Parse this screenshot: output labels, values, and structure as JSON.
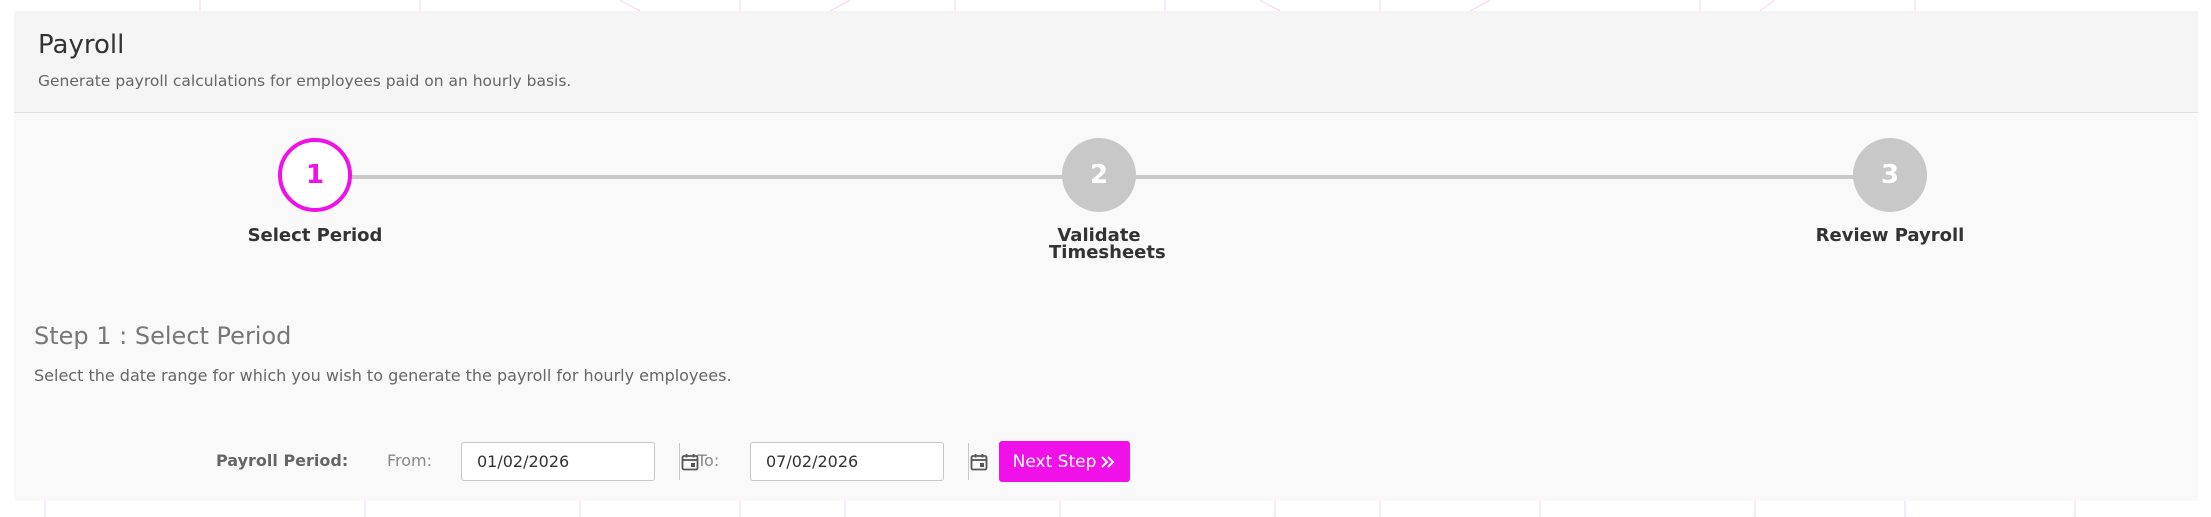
{
  "header": {
    "title": "Payroll",
    "subtitle": "Generate payroll calculations for employees paid on an hourly basis."
  },
  "wizard": {
    "steps": [
      {
        "number": "1",
        "label": "Select Period",
        "state": "active"
      },
      {
        "number": "2",
        "label": "Validate Timesheets",
        "state": "inactive"
      },
      {
        "number": "3",
        "label": "Review Payroll",
        "state": "inactive"
      }
    ]
  },
  "section": {
    "title": "Step 1 : Select Period",
    "description": "Select the date range for which you wish to generate the payroll for hourly employees."
  },
  "form": {
    "period_label": "Payroll Period:",
    "from_label": "From:",
    "from_value": "01/02/2026",
    "to_label": "To:",
    "to_value": "07/02/2026",
    "next_button_label": "Next Step",
    "next_button_icon": "double-chevron-right-icon"
  },
  "colors": {
    "accent": "#ef11e7",
    "inactive_step": "#c8c8c8"
  }
}
